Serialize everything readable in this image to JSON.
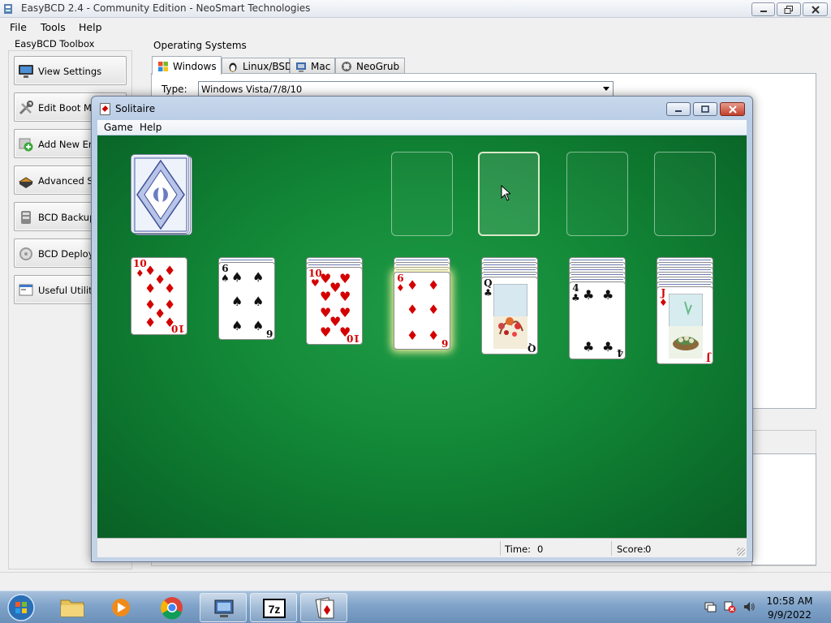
{
  "easybcd": {
    "title": "EasyBCD 2.4 - Community Edition - NeoSmart Technologies",
    "menu": [
      "File",
      "Tools",
      "Help"
    ],
    "toolbox_label": "EasyBCD Toolbox",
    "toolbox": [
      {
        "label": "View Settings",
        "icon": "monitor-icon"
      },
      {
        "label": "Edit Boot Menu",
        "icon": "tools-icon"
      },
      {
        "label": "Add New Entry",
        "icon": "add-entry-icon"
      },
      {
        "label": "Advanced Settings",
        "icon": "advanced-icon"
      },
      {
        "label": "BCD Backup/Repair",
        "icon": "backup-icon"
      },
      {
        "label": "BCD Deployment",
        "icon": "deploy-icon"
      },
      {
        "label": "Useful Utilities",
        "icon": "utilities-icon"
      }
    ],
    "os_label": "Operating Systems",
    "os_tabs": [
      {
        "label": "Windows",
        "icon": "windows-flag-icon",
        "active": true
      },
      {
        "label": "Linux/BSD",
        "icon": "tux-icon",
        "active": false
      },
      {
        "label": "Mac",
        "icon": "mac-icon",
        "active": false
      },
      {
        "label": "NeoGrub",
        "icon": "neogrub-icon",
        "active": false
      }
    ],
    "type_label": "Type:",
    "type_value": "Windows Vista/7/8/10"
  },
  "solitaire": {
    "title": "Solitaire",
    "menu": [
      "Game",
      "Help"
    ],
    "status": {
      "time_label": "Time:",
      "time_value": "0",
      "score_label": "Score:",
      "score_value": "0"
    },
    "tableau": [
      {
        "rank": "10",
        "suit": "♦",
        "color": "red",
        "hidden": 0
      },
      {
        "rank": "6",
        "suit": "♠",
        "color": "black",
        "hidden": 1
      },
      {
        "rank": "10",
        "suit": "♥",
        "color": "red",
        "hidden": 2
      },
      {
        "rank": "6",
        "suit": "♦",
        "color": "red",
        "hidden": 3,
        "selected": true
      },
      {
        "rank": "Q",
        "suit": "♣",
        "color": "black",
        "hidden": 4
      },
      {
        "rank": "4",
        "suit": "♣",
        "color": "black",
        "hidden": 5
      },
      {
        "rank": "J",
        "suit": "♦",
        "color": "red",
        "hidden": 6
      }
    ]
  },
  "taskbar": {
    "time": "10:58 AM",
    "date": "9/9/2022",
    "items": [
      "start-orb",
      "file-explorer",
      "media-player",
      "chrome",
      "easybcd",
      "7zip",
      "solitaire"
    ]
  },
  "colors": {
    "felt": "#138a38",
    "card_red": "#d40000",
    "taskbar": "#7fa3c9"
  }
}
